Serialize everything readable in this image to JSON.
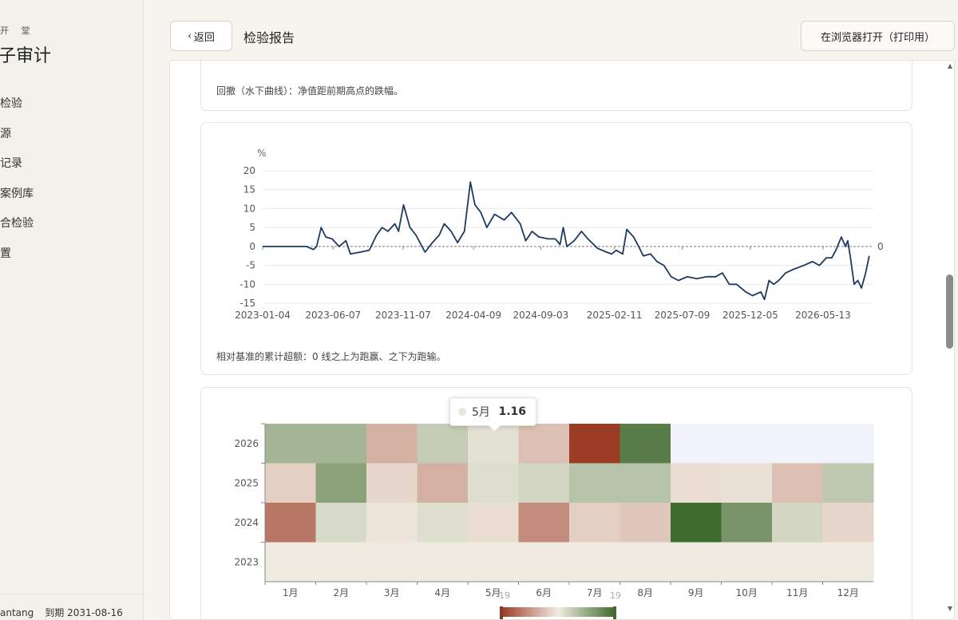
{
  "sidebar": {
    "brand_small": "开 堂",
    "brand_title": "子审计",
    "items": [
      {
        "label": "检验"
      },
      {
        "label": "源"
      },
      {
        "label": "记录"
      },
      {
        "label": "案例库"
      },
      {
        "label": "合检验"
      },
      {
        "label": "置"
      }
    ],
    "user": "antang",
    "expiry": "到期 2031-08-16"
  },
  "header": {
    "back_label": "返回",
    "title": "检验报告",
    "open_browser_label": "在浏览器打开（打印用）"
  },
  "sections": {
    "drawdown_note": "回撤（水下曲线）：净值距前期高点的跌幅。",
    "excess_note": "相对基准的累计超额：0 线之上为跑赢、之下为跑输。"
  },
  "tooltip": {
    "label": "5月",
    "value": "1.16"
  },
  "chart_data": [
    {
      "type": "line",
      "unit": "%",
      "x_ticks": [
        "2023-01-04",
        "2023-06-07",
        "2023-11-07",
        "2024-04-09",
        "2024-09-03",
        "2025-02-11",
        "2025-07-09",
        "2025-12-05",
        "2026-05-13"
      ],
      "y_ticks": [
        "20",
        "15",
        "10",
        "5",
        "0",
        "-5",
        "-10",
        "-15"
      ],
      "ylim": [
        -15,
        20
      ],
      "x_range": [
        "2023-01-04",
        "2026-08-31"
      ],
      "zero_line_label": "0",
      "line_color": "#1f3a5f",
      "points": [
        [
          "2023-01-04",
          0
        ],
        [
          "2023-04-10",
          0
        ],
        [
          "2023-04-25",
          -0.8
        ],
        [
          "2023-05-02",
          0
        ],
        [
          "2023-05-12",
          5
        ],
        [
          "2023-05-22",
          2.5
        ],
        [
          "2023-06-05",
          2
        ],
        [
          "2023-06-20",
          0
        ],
        [
          "2023-07-05",
          1.5
        ],
        [
          "2023-07-15",
          -2
        ],
        [
          "2023-08-05",
          -1.5
        ],
        [
          "2023-08-25",
          -1
        ],
        [
          "2023-09-10",
          3
        ],
        [
          "2023-09-22",
          5
        ],
        [
          "2023-10-05",
          4
        ],
        [
          "2023-10-20",
          6
        ],
        [
          "2023-10-28",
          4
        ],
        [
          "2023-11-08",
          11
        ],
        [
          "2023-11-22",
          5
        ],
        [
          "2023-12-05",
          3
        ],
        [
          "2023-12-25",
          -1.5
        ],
        [
          "2024-01-10",
          1
        ],
        [
          "2024-01-25",
          3
        ],
        [
          "2024-02-05",
          6
        ],
        [
          "2024-02-20",
          4
        ],
        [
          "2024-03-05",
          1
        ],
        [
          "2024-03-20",
          4
        ],
        [
          "2024-04-02",
          17
        ],
        [
          "2024-04-12",
          11
        ],
        [
          "2024-04-25",
          9
        ],
        [
          "2024-05-08",
          5
        ],
        [
          "2024-05-25",
          8.5
        ],
        [
          "2024-06-15",
          7
        ],
        [
          "2024-07-01",
          9
        ],
        [
          "2024-07-20",
          6
        ],
        [
          "2024-08-01",
          1.5
        ],
        [
          "2024-08-15",
          4
        ],
        [
          "2024-08-30",
          2.5
        ],
        [
          "2024-09-20",
          2
        ],
        [
          "2024-10-05",
          2
        ],
        [
          "2024-10-15",
          0.5
        ],
        [
          "2024-10-22",
          5
        ],
        [
          "2024-10-30",
          0
        ],
        [
          "2024-11-15",
          1.5
        ],
        [
          "2024-12-01",
          4
        ],
        [
          "2024-12-15",
          2
        ],
        [
          "2025-01-05",
          -0.5
        ],
        [
          "2025-01-25",
          -1.5
        ],
        [
          "2025-02-05",
          -2
        ],
        [
          "2025-02-15",
          -1
        ],
        [
          "2025-03-01",
          -2
        ],
        [
          "2025-03-10",
          4.5
        ],
        [
          "2025-03-25",
          2.5
        ],
        [
          "2025-04-05",
          0
        ],
        [
          "2025-04-15",
          -2.5
        ],
        [
          "2025-05-01",
          -2
        ],
        [
          "2025-05-15",
          -4
        ],
        [
          "2025-05-30",
          -5
        ],
        [
          "2025-06-15",
          -8
        ],
        [
          "2025-07-01",
          -9
        ],
        [
          "2025-07-20",
          -8
        ],
        [
          "2025-08-10",
          -8.5
        ],
        [
          "2025-09-01",
          -8
        ],
        [
          "2025-09-20",
          -8
        ],
        [
          "2025-10-05",
          -7
        ],
        [
          "2025-10-20",
          -10
        ],
        [
          "2025-11-05",
          -10
        ],
        [
          "2025-11-25",
          -12
        ],
        [
          "2025-12-10",
          -13
        ],
        [
          "2025-12-28",
          -12
        ],
        [
          "2026-01-05",
          -14
        ],
        [
          "2026-01-15",
          -9
        ],
        [
          "2026-01-25",
          -10
        ],
        [
          "2026-02-05",
          -9
        ],
        [
          "2026-02-20",
          -7
        ],
        [
          "2026-03-10",
          -6
        ],
        [
          "2026-04-01",
          -5
        ],
        [
          "2026-04-20",
          -4
        ],
        [
          "2026-05-05",
          -5
        ],
        [
          "2026-05-20",
          -3
        ],
        [
          "2026-06-01",
          -3
        ],
        [
          "2026-06-10",
          -1
        ],
        [
          "2026-06-22",
          2.5
        ],
        [
          "2026-07-01",
          0
        ],
        [
          "2026-07-06",
          1.5
        ],
        [
          "2026-07-12",
          -3
        ],
        [
          "2026-07-20",
          -10
        ],
        [
          "2026-07-28",
          -9
        ],
        [
          "2026-08-05",
          -11
        ],
        [
          "2026-08-14",
          -7
        ],
        [
          "2026-08-22",
          -2.5
        ]
      ]
    },
    {
      "type": "heatmap",
      "x_categories": [
        "1月",
        "2月",
        "3月",
        "4月",
        "5月",
        "6月",
        "7月",
        "8月",
        "9月",
        "10月",
        "11月",
        "12月"
      ],
      "y_categories": [
        "2026",
        "2025",
        "2024",
        "2023"
      ],
      "colors": {
        "negative": "#9c3b26",
        "mid": "#f1ece2",
        "positive": "#3e6b2e"
      },
      "visual_range_labels": [
        "19",
        "19"
      ],
      "values": [
        [
          6,
          6,
          -4,
          3.5,
          1.16,
          -3,
          -12,
          12,
          -0.3,
          -0.8,
          -0.5,
          -0.8
        ],
        [
          -2,
          8,
          -1.5,
          -4,
          1.5,
          2.5,
          4.5,
          4.5,
          -1,
          -0.8,
          -3,
          4
        ],
        [
          -8,
          2,
          -0.5,
          1.5,
          -1,
          -6.5,
          -2,
          -2.5,
          14,
          9.5,
          2.5,
          -1.5
        ],
        [
          0.1,
          0.1,
          0.1,
          0.1,
          0.1,
          0.1,
          0.1,
          0.1,
          0.1,
          0.1,
          0.1,
          0.1
        ]
      ]
    }
  ]
}
